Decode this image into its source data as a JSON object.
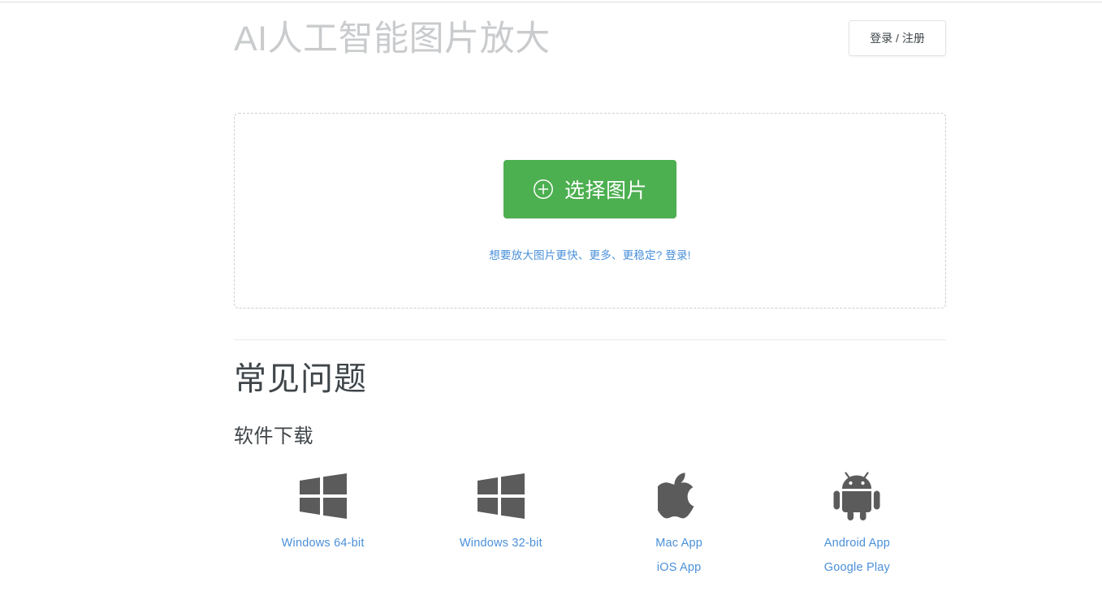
{
  "header": {
    "site_title": "AI人工智能图片放大",
    "auth_button_label": "登录 / 注册"
  },
  "dropzone": {
    "choose_button_label": "选择图片",
    "choose_button_icon": "plus-circle-icon",
    "upsell_link": "想要放大图片更快、更多、更稳定? 登录!"
  },
  "faq": {
    "title": "常见问题",
    "subtitle": "软件下载"
  },
  "downloads": [
    {
      "icon": "windows-icon",
      "links": [
        "Windows 64-bit"
      ]
    },
    {
      "icon": "windows-icon",
      "links": [
        "Windows 32-bit"
      ]
    },
    {
      "icon": "apple-icon",
      "links": [
        "Mac App",
        "iOS App"
      ]
    },
    {
      "icon": "android-icon",
      "links": [
        "Android App",
        "Google Play"
      ]
    }
  ],
  "colors": {
    "accent_green": "#4caf50",
    "link_blue": "#4a90d9",
    "title_gray": "#c9cbcd",
    "text_dark": "#3f4549",
    "icon_gray": "#5b5b5b",
    "border_light": "#e3e3e3",
    "dashed_border": "#cfcfcf"
  }
}
